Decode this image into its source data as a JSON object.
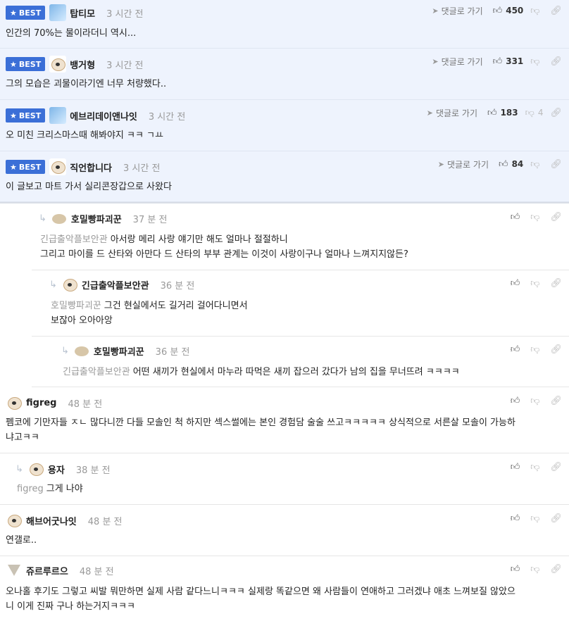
{
  "best_label": "BEST",
  "reply_label": "댓글로 가기",
  "best_comments": [
    {
      "nick": "탑티모",
      "time": "3 시간 전",
      "text": "인간의 70%는 물이라더니 역시...",
      "likes": "450",
      "dislikes": ""
    },
    {
      "nick": "뱅거형",
      "time": "3 시간 전",
      "text": "그의 모습은 괴물이라기엔 너무 처량했다..",
      "likes": "331",
      "dislikes": ""
    },
    {
      "nick": "에브리데이앤나잇",
      "time": "3 시간 전",
      "text": "오 미친 크리스마스때 해봐야지 ㅋㅋ ㄱㅛ",
      "likes": "183",
      "dislikes": "4"
    },
    {
      "nick": "직언합니다",
      "time": "3 시간 전",
      "text": "이 글보고 마트 가서 실리콘장갑으로 사왔다",
      "likes": "84",
      "dislikes": ""
    }
  ],
  "replies": [
    {
      "nick": "호밀빵파괴꾼",
      "time": "37 분 전",
      "mention": "긴급출악플보안관",
      "line1": "아서랑 메리 사랑 얘기만 해도 얼마나 절절하니",
      "line2": "그리고 마이를 드 산타와 아만다 드 산타의 부부 관계는 이것이 사랑이구나 얼마나 느껴지지않든?"
    },
    {
      "nick": "긴급출악플보안관",
      "time": "36 분 전",
      "mention": "호밀빵파괴꾼",
      "line1": "그건 현실에서도 길거리 걸어다니면서",
      "line2": "보잖아 오아아앙"
    },
    {
      "nick": "호밀빵파괴꾼",
      "time": "36 분 전",
      "mention": "긴급출악플보안관",
      "line1": "어떤 새끼가 현실에서 마누라 따먹은 새끼 잡으러 갔다가 남의 집을 무너뜨려 ㅋㅋㅋㅋ"
    }
  ],
  "comments": [
    {
      "nick": "figreg",
      "time": "48 분 전",
      "line1": "펨코에 기만자들 ㅈㄴ 많다니깐 다들 모솔인 척 하지만 섹스썰에는 본인 경험담 술술 쓰고ㅋㅋㅋㅋㅋ 상식적으로 서른살 모솔이 가능하",
      "line2": "냐고ㅋㅋ"
    },
    {
      "nick": "용자",
      "time": "38 분 전",
      "mention": "figreg",
      "line1": "그게 나야"
    },
    {
      "nick": "해브어굿나잇",
      "time": "48 분 전",
      "line1": "연갤로.."
    },
    {
      "nick": "쥬르루르으",
      "time": "48 분 전",
      "line1": "오나홀 후기도 그렇고 씨발 뭐만하면 실제 사람 같다느니ㅋㅋㅋ 실제랑 똑같으면 왜 사람들이 연애하고 그러겠냐 애초 느껴보질 않았으",
      "line2": "니 이게 진짜 구나 하는거지ㅋㅋㅋ"
    }
  ],
  "icons": {
    "best": "star-icon",
    "reply": "paper-plane-icon",
    "like": "thumbs-up-icon",
    "dislike": "thumbs-down-icon",
    "share": "link-icon",
    "reply_indent": "reply-arrow-icon"
  },
  "colors": {
    "best_bg": "#eef3fd",
    "badge": "#3b6fd7"
  }
}
